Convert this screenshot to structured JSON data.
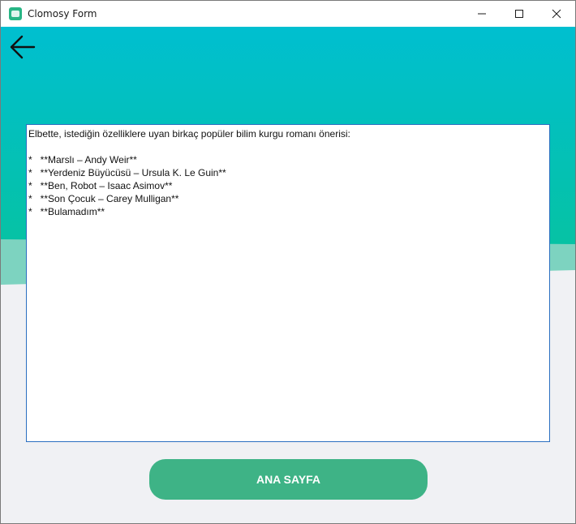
{
  "window": {
    "title": "Clomosy Form"
  },
  "icons": {
    "app": "clomosy-app-icon",
    "back": "arrow-left-icon",
    "minimize": "minimize-icon",
    "maximize": "maximize-icon",
    "close": "close-icon"
  },
  "colors": {
    "header_gradient_top": "#00bfd0",
    "header_gradient_bottom": "#08c2a8",
    "button_green": "#3eb386",
    "background": "#f0f1f4",
    "textbox_border": "#2a6fc0"
  },
  "main": {
    "response_text": "Elbette, istediğin özelliklere uyan birkaç popüler bilim kurgu romanı önerisi:\n\n*   **Marslı – Andy Weir**\n*   **Yerdeniz Büyücüsü – Ursula K. Le Guin**\n*   **Ben, Robot – Isaac Asimov**\n*   **Son Çocuk – Carey Mulligan**\n*   **Bulamadım**",
    "home_button_label": "ANA SAYFA"
  }
}
